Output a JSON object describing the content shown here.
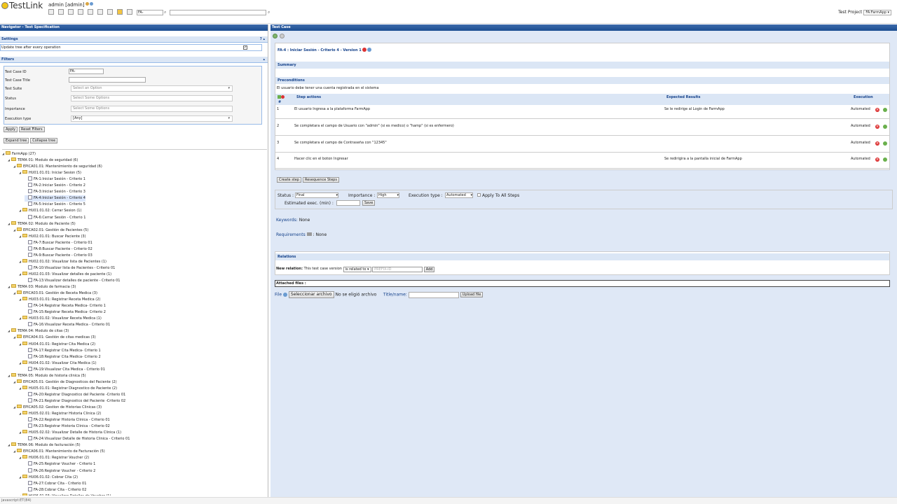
{
  "header": {
    "logo": "TestLink",
    "user": "admin [admin]",
    "tc_search_value": "FA-",
    "project_label": "Test Project",
    "project_value": "FA:FarmApp"
  },
  "navigator": {
    "title": "Navigator - Test Specification",
    "settings_title": "Settings",
    "update_tree_label": "Update tree after every operation",
    "filters_title": "Filters",
    "filters": {
      "tc_id_label": "Test Case ID",
      "tc_id_value": "FA-",
      "tc_title_label": "Test Case Title",
      "suite_label": "Test Suite",
      "suite_placeholder": "Select an Option",
      "status_label": "Status",
      "status_placeholder": "Select Some Options",
      "importance_label": "Importance",
      "importance_placeholder": "Select Some Options",
      "exec_type_label": "Execution type",
      "exec_type_value": "[Any]"
    },
    "apply": "Apply",
    "reset": "Reset Filters",
    "expand": "Expand tree",
    "collapse": "Collapse tree"
  },
  "tree": [
    {
      "label": "FarmApp (27)",
      "level": 0,
      "type": "folder"
    },
    {
      "label": "TEMA 01: Modulo de seguridad (6)",
      "level": 1,
      "type": "folder"
    },
    {
      "label": "EPICA01.01: Mantenimiento de seguridad (6)",
      "level": 2,
      "type": "folder"
    },
    {
      "label": "HU01.01.01: Iniciar Sesion (5)",
      "level": 3,
      "type": "folder"
    },
    {
      "label": "FA-1:Iniciar Sesión - Criterio 1",
      "level": 4,
      "type": "leaf"
    },
    {
      "label": "FA-2:Iniciar Sesión - Criterio 2",
      "level": 4,
      "type": "leaf"
    },
    {
      "label": "FA-3:Iniciar Sesión - Criterio 3",
      "level": 4,
      "type": "leaf"
    },
    {
      "label": "FA-4:Iniciar Sesión - Criterio 4",
      "level": 4,
      "type": "leaf",
      "selected": true
    },
    {
      "label": "FA-5:Iniciar Sesión - Criterio 5",
      "level": 4,
      "type": "leaf"
    },
    {
      "label": "HU01.01.02: Cerrar Sesion (1)",
      "level": 3,
      "type": "folder"
    },
    {
      "label": "FA-6:Cerrar Sesión - Criterio 1",
      "level": 4,
      "type": "leaf"
    },
    {
      "label": "TEMA 02: Modulo de Paciente (5)",
      "level": 1,
      "type": "folder"
    },
    {
      "label": "EPICA02.01: Gestión de Pacientes (5)",
      "level": 2,
      "type": "folder"
    },
    {
      "label": "HU02.01.01: Buscar Paciente (3)",
      "level": 3,
      "type": "folder"
    },
    {
      "label": "FA-7:Buscar Paciente - Criterio 01",
      "level": 4,
      "type": "leaf"
    },
    {
      "label": "FA-8:Buscar Paciente - Criterio 02",
      "level": 4,
      "type": "leaf"
    },
    {
      "label": "FA-9:Buscar Paciente - Criterio 03",
      "level": 4,
      "type": "leaf"
    },
    {
      "label": "HU02.01.02: Visualizar lista de Pacientes (1)",
      "level": 3,
      "type": "folder"
    },
    {
      "label": "FA-10:Visualizar lista de Pacientes - Criterio 01",
      "level": 4,
      "type": "leaf"
    },
    {
      "label": "HU02.01.03: Visualizar detalles de paciente (1)",
      "level": 3,
      "type": "folder"
    },
    {
      "label": "FA-13:Visualizar detalles de paciente - Criterio 01",
      "level": 4,
      "type": "leaf"
    },
    {
      "label": "TEMA 03: Modulo de farmacia (3)",
      "level": 1,
      "type": "folder"
    },
    {
      "label": "EPICA03.01: Gestión de Receta Medica (3)",
      "level": 2,
      "type": "folder"
    },
    {
      "label": "HU03.01.01: Registrar Receta Medica (2)",
      "level": 3,
      "type": "folder"
    },
    {
      "label": "FA-14:Registrar Receta Medica- Criterio 1",
      "level": 4,
      "type": "leaf"
    },
    {
      "label": "FA-15:Registrar Receta Medica- Criterio 2",
      "level": 4,
      "type": "leaf"
    },
    {
      "label": "HU03.01.02: Visualizar Receta Medica (1)",
      "level": 3,
      "type": "folder"
    },
    {
      "label": "FA-16:Visualizar Receta Medica - Criterio 01",
      "level": 4,
      "type": "leaf"
    },
    {
      "label": "TEMA 04: Modulo de citas (3)",
      "level": 1,
      "type": "folder"
    },
    {
      "label": "EPICA04.01: Gestión de citas medicas (3)",
      "level": 2,
      "type": "folder"
    },
    {
      "label": "HU04.01.01: Registrar Cita Medica (2)",
      "level": 3,
      "type": "folder"
    },
    {
      "label": "FA-17:Registrar Cita Medica- Criterio 1",
      "level": 4,
      "type": "leaf"
    },
    {
      "label": "FA-18:Registrar Cita Medica- Criterio 2",
      "level": 4,
      "type": "leaf"
    },
    {
      "label": "HU04.01.02: Visualizar Cita Medica (1)",
      "level": 3,
      "type": "folder"
    },
    {
      "label": "FA-19:Visualizar Cita Medica - Criterio 01",
      "level": 4,
      "type": "leaf"
    },
    {
      "label": "TEMA 05: Modulo de historia clinica (5)",
      "level": 1,
      "type": "folder"
    },
    {
      "label": "EPICA05.01: Gestión de Diagnosticos del Paciente (2)",
      "level": 2,
      "type": "folder"
    },
    {
      "label": "HU05.01.01: Registrar Diagnostico de Paciente (2)",
      "level": 3,
      "type": "folder"
    },
    {
      "label": "FA-20:Registrar Diagnostico del Paciente -Criterio 01",
      "level": 4,
      "type": "leaf"
    },
    {
      "label": "FA-21:Registrar Diagnostico del Paciente -Criterio 02",
      "level": 4,
      "type": "leaf"
    },
    {
      "label": "EPICA05.02: Gestion de Historias Clinicas (3)",
      "level": 2,
      "type": "folder"
    },
    {
      "label": "HU05.02.01: Registrar Historia Clinica (2)",
      "level": 3,
      "type": "folder"
    },
    {
      "label": "FA-22:Registrar Historia Clinica - Criterio 01",
      "level": 4,
      "type": "leaf"
    },
    {
      "label": "FA-23:Registrar Historia Clinica - Criterio 02",
      "level": 4,
      "type": "leaf"
    },
    {
      "label": "HU05.02.02: Visualizar Detalle de Historia Clinica (1)",
      "level": 3,
      "type": "folder"
    },
    {
      "label": "FA-24:Visualizar Detalle de Historia Clinica - Criterio 01",
      "level": 4,
      "type": "leaf"
    },
    {
      "label": "TEMA 06: Modulo de facturación (5)",
      "level": 1,
      "type": "folder"
    },
    {
      "label": "EPICA06.01: Mantenimiento de Facturación (5)",
      "level": 2,
      "type": "folder"
    },
    {
      "label": "HU06.01.01: Registrar Voucher (2)",
      "level": 3,
      "type": "folder"
    },
    {
      "label": "FA-25:Registrar Voucher - Criterio 1",
      "level": 4,
      "type": "leaf"
    },
    {
      "label": "FA-26:Registrar Voucher - Criterio 2",
      "level": 4,
      "type": "leaf"
    },
    {
      "label": "HU06.01.02: Cobrar Cita (2)",
      "level": 3,
      "type": "folder"
    },
    {
      "label": "FA-27:Cobrar Cita - Criterio 01",
      "level": 4,
      "type": "leaf"
    },
    {
      "label": "FA-28:Cobrar Cita - Criterio 02",
      "level": 4,
      "type": "leaf"
    },
    {
      "label": "HU06.01.03: Visualizar Detalles de Voucher (1)",
      "level": 3,
      "type": "folder"
    }
  ],
  "testcase": {
    "panel_title": "Test Case",
    "title": "FA-4 : Iniciar Sesión - Criterio 4 - Version 1",
    "summary_label": "Summary",
    "preconditions_label": "Preconditions",
    "preconditions_text": "El usuario debe tener una cuenta registrada en el sistema",
    "steps_header": {
      "num": "#",
      "actions": "Step actions",
      "expected": "Expected Results",
      "execution": "Execution"
    },
    "steps": [
      {
        "num": "1",
        "action": "El usuario Ingresa a la plataforma FarmApp",
        "expected": "Se le redirige al Login de FarmApp",
        "execution": "Automated"
      },
      {
        "num": "2",
        "action": "Se completara el campo de Usuario con \"admin\" (si es medico) o \"hamp\" (si es enfermero)",
        "expected": "",
        "execution": "Automated"
      },
      {
        "num": "3",
        "action": "Se completara el campo de Contraseña con \"12345\"",
        "expected": "",
        "execution": "Automated"
      },
      {
        "num": "4",
        "action": "Hacer clic en el boton Ingresar",
        "expected": "Se redirigira a la pantalla inicial de FarmApp",
        "execution": "Automated"
      }
    ],
    "create_step": "Create step",
    "resequence": "Resequence Steps",
    "status_label": "Status :",
    "status_value": "Final",
    "importance_label": "Importance :",
    "importance_value": "High",
    "exec_type_label": "Execution type :",
    "exec_type_value": "Automated",
    "apply_all": "Apply To All Steps",
    "estimated_label": "Estimated exec. (min) :",
    "save": "Save",
    "keywords_label": "Keywords:",
    "keywords_value": "None",
    "requirements_label": "Requirements",
    "requirements_value": "None",
    "relations_label": "Relations",
    "new_relation_label": "New relation:",
    "new_relation_text": "This test case version",
    "relation_type": "is related to",
    "prefix_placeholder": "PREFIX-ID",
    "add": "Add",
    "attached_label": "Attached files :",
    "file_label": "File",
    "choose_file": "Seleccionar archivo",
    "no_file": "No se eligió archivo",
    "title_label": "Title/name:",
    "upload": "Upload file"
  },
  "statusbar": "javascript:ET(84)"
}
